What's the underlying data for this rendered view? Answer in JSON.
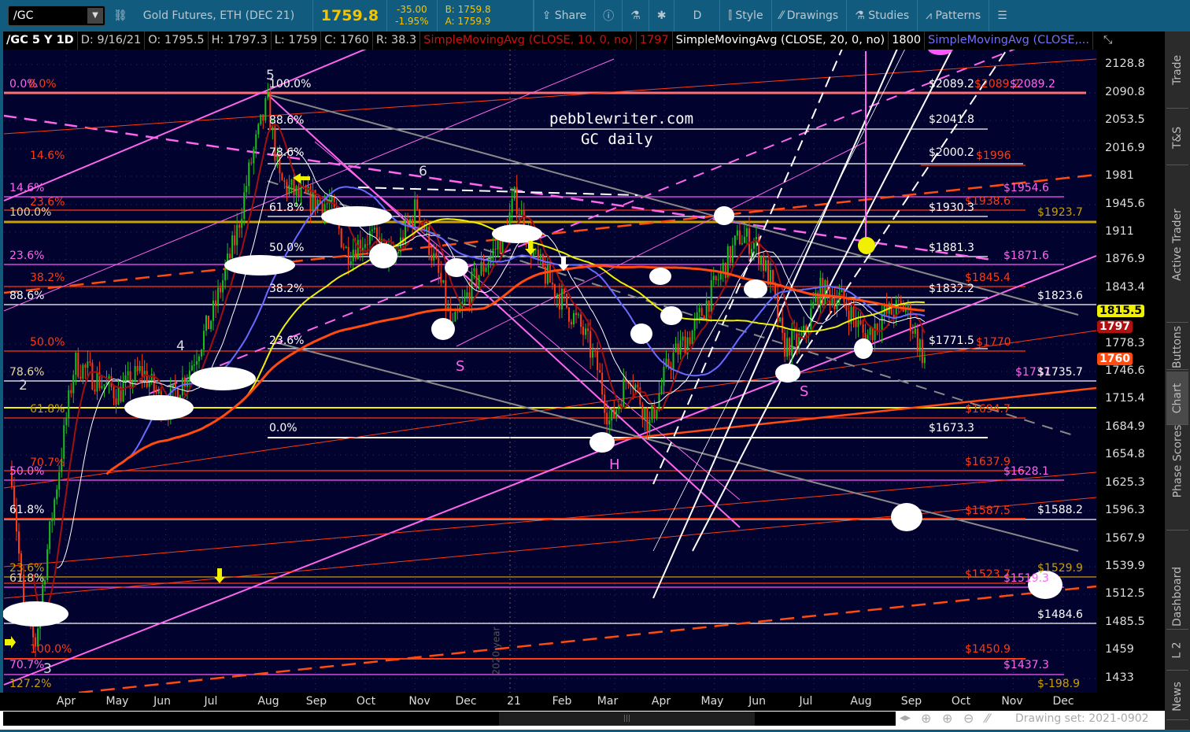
{
  "toolbar": {
    "symbol": "/GC",
    "description": "Gold Futures, ETH (DEC 21)",
    "last": "1759.8",
    "change": "-35.00",
    "change_pct": "-1.95%",
    "bid": "B: 1759.8",
    "ask": "A: 1759.9",
    "share": "Share",
    "period": "D",
    "style": "Style",
    "drawings": "Drawings",
    "studies": "Studies",
    "patterns": "Patterns"
  },
  "header": {
    "title": "/GC 5 Y 1D",
    "date": "D: 9/16/21",
    "open": "O: 1795.5",
    "high": "H: 1797.3",
    "low": "L: 1759",
    "close": "C: 1760",
    "range": "R: 38.3",
    "sma10": "SimpleMovingAvg (CLOSE, 10, 0, no)",
    "sma10_val": "1797",
    "sma20": "SimpleMovingAvg (CLOSE, 20, 0, no)",
    "sma20_val": "1800",
    "sma50": "SimpleMovingAvg (CLOSE,..."
  },
  "watermark": {
    "site": "pebblewriter.com",
    "subtitle": "GC daily"
  },
  "price_axis": [
    "2128.8",
    "2090.8",
    "2053.5",
    "2016.9",
    "1981",
    "1945.6",
    "1911",
    "1876.9",
    "1843.4",
    "1778.3",
    "1746.6",
    "1715.4",
    "1684.9",
    "1654.8",
    "1625.3",
    "1596.3",
    "1567.9",
    "1539.9",
    "1512.5",
    "1485.5",
    "1459",
    "1433"
  ],
  "price_bubbles": {
    "sma_yellow": "1815.5",
    "sma10": "1797",
    "last": "1760"
  },
  "time_axis": [
    "Apr",
    "May",
    "Jun",
    "Jul",
    "Aug",
    "Sep",
    "Oct",
    "Nov",
    "Dec",
    "21",
    "Feb",
    "Mar",
    "Apr",
    "May",
    "Jun",
    "Jul",
    "Aug",
    "Sep",
    "Oct",
    "Nov",
    "Dec"
  ],
  "year_marker": "2020 year",
  "level_labels": [
    "$2089.2",
    "$2089.2",
    "$2089.2",
    "$2041.8",
    "$2000.2",
    "$1996",
    "$1954.6",
    "$1938.6",
    "$1930.3",
    "$1923.7",
    "$1881.3",
    "$1871.6",
    "$1845.4",
    "$1832.2",
    "$1823.6",
    "$1771.5",
    "$1770",
    "$1737",
    "$1735.7",
    "$1694.7",
    "$1673.3",
    "$1637.9",
    "$1628.1",
    "$1587.5",
    "$1588.2",
    "$1529.9",
    "$1523.7",
    "$1519.3",
    "$1484.6",
    "$1450.9",
    "$1437.3",
    "$-198.9"
  ],
  "fib_left": [
    "0.0%",
    "0.0%",
    "14.6%",
    "14.6%",
    "23.6%",
    "100.0%",
    "23.6%",
    "38.2%",
    "88.6%",
    "50.0%",
    "78.6%",
    "61.8%",
    "70.7%",
    "50.0%",
    "61.8%",
    "23.6%",
    "61.8%",
    "100.0%",
    "70.7%",
    "127.2%"
  ],
  "fib_mid": [
    "100.0%",
    "88.6%",
    "78.6%",
    "61.8%",
    "50.0%",
    "38.2%",
    "23.6%",
    "0.0%"
  ],
  "waves": [
    "5",
    "6",
    "4",
    "2",
    "3",
    "S",
    "H",
    "S"
  ],
  "tabs": [
    "Trade",
    "T&S",
    "Active Trader",
    "Buttons",
    "Chart",
    "Phase Scores",
    "Dashboard",
    "L 2",
    "News"
  ],
  "footer": {
    "drawing_set": "Drawing set: 2021-0902"
  },
  "colors": {
    "up": "#18c018",
    "down": "#ff3a10",
    "bg": "#02022f",
    "sma10": "#a01010",
    "sma20": "#ffffff",
    "sma50": "#6a6aff",
    "sma100": "#f0f000",
    "sma200": "#ff4a10"
  },
  "chart_data": {
    "type": "candlestick",
    "scale": "log",
    "ylim": [
      1433,
      2128.8
    ],
    "x_unit": "months since Apr 2020",
    "anchors": [
      [
        -1.09,
        1637
      ],
      [
        -0.85,
        1494
      ],
      [
        -0.62,
        1464
      ],
      [
        -0.38,
        1556
      ],
      [
        -0.06,
        1670
      ],
      [
        0.17,
        1757
      ],
      [
        0.57,
        1740
      ],
      [
        1.04,
        1722
      ],
      [
        1.52,
        1748
      ],
      [
        1.99,
        1705
      ],
      [
        2.46,
        1748
      ],
      [
        2.94,
        1812
      ],
      [
        3.41,
        1906
      ],
      [
        3.73,
        2005
      ],
      [
        4.04,
        2078
      ],
      [
        4.28,
        1975
      ],
      [
        4.67,
        1955
      ],
      [
        5.3,
        1945
      ],
      [
        5.62,
        1887
      ],
      [
        6.09,
        1906
      ],
      [
        6.57,
        1877
      ],
      [
        7.04,
        1945
      ],
      [
        7.51,
        1849
      ],
      [
        7.75,
        1793
      ],
      [
        8.15,
        1849
      ],
      [
        8.78,
        1906
      ],
      [
        9.01,
        1955
      ],
      [
        9.41,
        1877
      ],
      [
        9.72,
        1849
      ],
      [
        10.36,
        1793
      ],
      [
        10.67,
        1748
      ],
      [
        10.91,
        1687
      ],
      [
        11.3,
        1748
      ],
      [
        11.7,
        1687
      ],
      [
        12.09,
        1757
      ],
      [
        12.57,
        1793
      ],
      [
        13.04,
        1849
      ],
      [
        13.51,
        1906
      ],
      [
        13.83,
        1896
      ],
      [
        14.14,
        1849
      ],
      [
        14.38,
        1775
      ],
      [
        14.78,
        1784
      ],
      [
        15.09,
        1840
      ],
      [
        15.56,
        1830
      ],
      [
        16.04,
        1784
      ],
      [
        16.35,
        1810
      ],
      [
        16.83,
        1821
      ],
      [
        17.22,
        1760
      ]
    ]
  }
}
